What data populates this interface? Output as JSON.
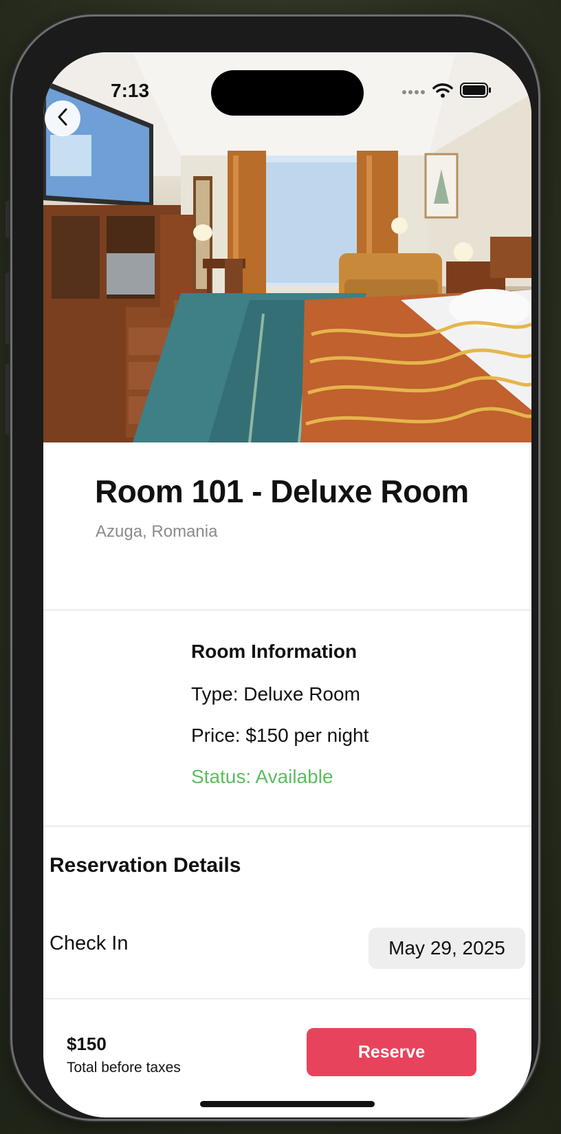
{
  "status_bar": {
    "time": "7:13",
    "icons": [
      "signal-dots-icon",
      "wifi-icon",
      "battery-icon"
    ]
  },
  "nav": {
    "back_icon": "chevron-left-icon"
  },
  "room": {
    "title": "Room 101 - Deluxe Room",
    "location": "Azuga, Romania"
  },
  "room_info": {
    "heading": "Room Information",
    "type": "Type: Deluxe Room",
    "price": "Price: $150 per night",
    "status": "Status: Available",
    "status_color": "#5bbd5e"
  },
  "reservation": {
    "heading": "Reservation Details",
    "check_in_label": "Check In",
    "check_in_date": "May 29, 2025"
  },
  "footer": {
    "price": "$150",
    "price_caption": "Total before taxes",
    "reserve_label": "Reserve",
    "reserve_color": "#e8435c"
  }
}
